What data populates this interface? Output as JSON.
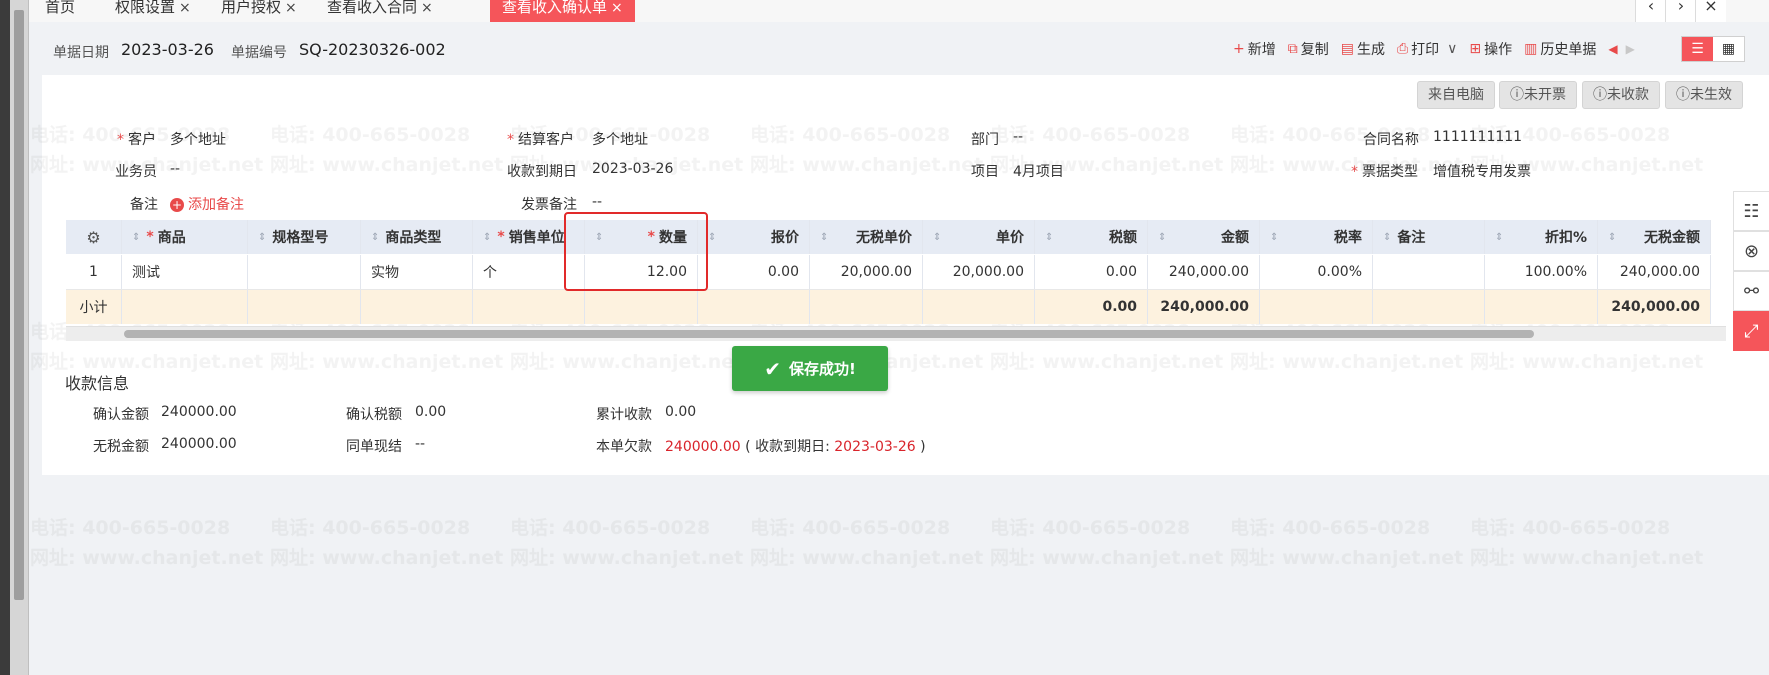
{
  "tabs": [
    {
      "label": "首页"
    },
    {
      "label": "权限设置"
    },
    {
      "label": "用户授权"
    },
    {
      "label": "查看收入合同"
    },
    {
      "label": "查看收入确认单"
    }
  ],
  "tab_close": "×",
  "tab_controls": [
    "‹",
    "›",
    "×"
  ],
  "doc_info": {
    "date_label": "单据日期",
    "date_value": "2023-03-26",
    "number_label": "单据编号",
    "number_value": "SQ-20230326-002"
  },
  "toolbar": [
    {
      "label": "新增",
      "icon": "plus-icon",
      "glyph": "+"
    },
    {
      "label": "复制",
      "icon": "copy-icon",
      "glyph": "⧉"
    },
    {
      "label": "生成",
      "icon": "document-icon",
      "glyph": "▤"
    },
    {
      "label": "打印",
      "icon": "printer-icon",
      "glyph": "⎙"
    },
    {
      "label": "操作",
      "icon": "grid-icon",
      "glyph": "⊞"
    },
    {
      "label": "历史单据",
      "icon": "history-icon",
      "glyph": "▥"
    }
  ],
  "print_dropdown": "∨",
  "nav_prev": "◀",
  "nav_next": "▶",
  "view_toggle": [
    "☰",
    "▦"
  ],
  "status_pills": [
    "来自电脑",
    "未开票",
    "未收款",
    "未生效"
  ],
  "status_info_glyph": "ⓘ",
  "form": {
    "customer_label": "客户",
    "customer_value": "多个地址",
    "settle_label": "结算客户",
    "settle_value": "多个地址",
    "dept_label": "部门",
    "dept_value": "--",
    "contract_label": "合同名称",
    "contract_value": "1111111111",
    "salesman_label": "业务员",
    "salesman_value": "--",
    "due_label": "收款到期日",
    "due_value": "2023-03-26",
    "project_label": "项目",
    "project_value": "4月项目",
    "invoice_type_label": "票据类型",
    "invoice_type_value": "增值税专用发票",
    "remark_label": "备注",
    "add_remark": "添加备注",
    "invoice_remark_label": "发票备注",
    "invoice_remark_value": "--"
  },
  "table": {
    "gear_icon": "⚙",
    "columns": [
      "商品",
      "规格型号",
      "商品类型",
      "销售单位",
      "数量",
      "报价",
      "无税单价",
      "单价",
      "税额",
      "金额",
      "税率",
      "备注",
      "折扣%",
      "无税金额"
    ],
    "rows": [
      [
        "1",
        "测试",
        "",
        "实物",
        "个",
        "12.00",
        "0.00",
        "20,000.00",
        "20,000.00",
        "0.00",
        "240,000.00",
        "0.00%",
        "",
        "100.00%",
        "240,000.00"
      ]
    ],
    "subtotal": [
      "小计",
      "",
      "",
      "",
      "",
      "",
      "",
      "",
      "",
      "0.00",
      "240,000.00",
      "",
      "",
      "",
      "240,000.00"
    ]
  },
  "toast": {
    "text": "保存成功!",
    "glyph": "✔"
  },
  "collection": {
    "title": "收款信息",
    "confirm_amount_label": "确认金额",
    "confirm_amount_value": "240000.00",
    "confirm_tax_label": "确认税额",
    "confirm_tax_value": "0.00",
    "total_collect_label": "累计收款",
    "total_collect_value": "0.00",
    "notax_amount_label": "无税金额",
    "notax_amount_value": "240000.00",
    "same_settle_label": "同单现结",
    "same_settle_value": "--",
    "owed_label": "本单欠款",
    "owed_value": "240000.00",
    "owed_note_open": "( 收款到期日:",
    "owed_due": "2023-03-26",
    "owed_note_close": ")"
  },
  "side_icons": [
    {
      "icon": "form-icon",
      "glyph": "☷"
    },
    {
      "icon": "audit-icon",
      "glyph": "⊗"
    },
    {
      "icon": "link-icon",
      "glyph": "⚯"
    },
    {
      "icon": "expand-icon",
      "glyph": "⤢"
    }
  ],
  "watermark": {
    "phone": "电话: 400-665-0028",
    "site": "网址: www.chanjet.net"
  },
  "colors": {
    "accent": "#f5555a",
    "success": "#3aa845",
    "required": "#e84a4a",
    "header_bg": "#e6ebf4",
    "subtotal_bg": "#fdf2df"
  }
}
